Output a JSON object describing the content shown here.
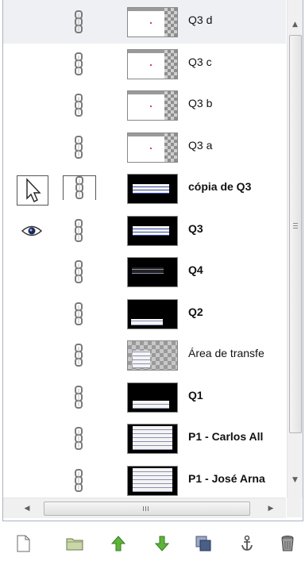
{
  "layers": [
    {
      "name": "Q3 d",
      "bold": false,
      "thumb": "white-edge",
      "visible": false,
      "selected": true
    },
    {
      "name": "Q3 c",
      "bold": false,
      "thumb": "white-edge",
      "visible": false,
      "selected": false
    },
    {
      "name": "Q3 b",
      "bold": false,
      "thumb": "white-edge",
      "visible": false,
      "selected": false
    },
    {
      "name": "Q3 a",
      "bold": false,
      "thumb": "white-edge",
      "visible": false,
      "selected": false
    },
    {
      "name": "cópia de Q3",
      "bold": true,
      "thumb": "black-scribble",
      "visible": false,
      "selected": false
    },
    {
      "name": "Q3",
      "bold": true,
      "thumb": "black-scribble",
      "visible": true,
      "selected": false
    },
    {
      "name": "Q4",
      "bold": true,
      "thumb": "black-small",
      "visible": false,
      "selected": false
    },
    {
      "name": "Q2",
      "bold": true,
      "thumb": "black-bottom",
      "visible": false,
      "selected": false
    },
    {
      "name": "Área de transfe",
      "bold": false,
      "thumb": "checker",
      "visible": false,
      "selected": false
    },
    {
      "name": "Q1",
      "bold": true,
      "thumb": "black-bottom-wide",
      "visible": false,
      "selected": false
    },
    {
      "name": "P1 - Carlos All",
      "bold": true,
      "thumb": "paper",
      "visible": false,
      "selected": false
    },
    {
      "name": "P1 - José Arna",
      "bold": true,
      "thumb": "paper",
      "visible": false,
      "selected": false
    }
  ],
  "scroll": {
    "grip_label": "III"
  },
  "toolbar": {
    "buttons": [
      "new-layer-icon",
      "new-group-icon",
      "raise-layer-icon",
      "lower-layer-icon",
      "duplicate-layer-icon",
      "anchor-layer-icon",
      "delete-layer-icon"
    ]
  },
  "colors": {
    "selected_row": "#eef0f3",
    "arrow_green": "#4aa02c",
    "border": "#a9b3bf"
  }
}
